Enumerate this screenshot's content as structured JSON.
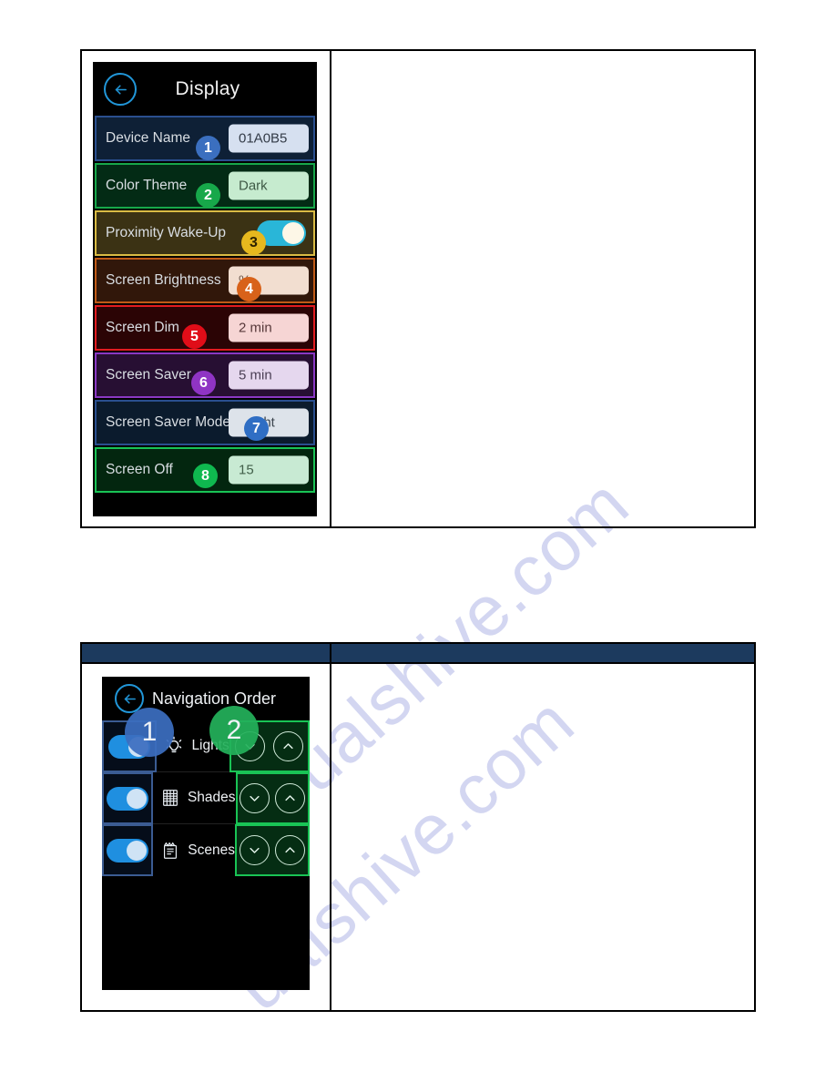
{
  "document": {
    "watermark": "ualshive.com"
  },
  "panel1": {
    "device": {
      "title": "Display",
      "back_icon": "arrow-left-icon",
      "rows": [
        {
          "label": "Device Name",
          "value": "01A0B5",
          "badge": "1",
          "badge_color": "#3b6fbf",
          "control": "value"
        },
        {
          "label": "Color Theme",
          "value": "Dark",
          "badge": "2",
          "badge_color": "#17a84a",
          "control": "value"
        },
        {
          "label": "Proximity Wake-Up",
          "value": "",
          "badge": "3",
          "badge_color": "#e6b81e",
          "control": "toggle"
        },
        {
          "label": "Screen Brightness",
          "value": "%",
          "badge": "4",
          "badge_color": "#d8621a",
          "control": "value"
        },
        {
          "label": "Screen Dim",
          "value": "2 min",
          "badge": "5",
          "badge_color": "#e00d18",
          "control": "value"
        },
        {
          "label": "Screen Saver",
          "value": "5 min",
          "badge": "6",
          "badge_color": "#8f34c4",
          "control": "value"
        },
        {
          "label": "Screen Saver Mode",
          "value": "ght",
          "badge": "7",
          "badge_color": "#2f6ec4",
          "control": "value"
        },
        {
          "label": "Screen Off",
          "value": "15",
          "badge": "8",
          "badge_color": "#0fb84f",
          "control": "value"
        }
      ]
    },
    "right_cell": ""
  },
  "panel2": {
    "header_color": "#1c3a5e",
    "header_left": "",
    "header_right": "",
    "device": {
      "title": "Navigation Order",
      "back_icon": "arrow-left-icon",
      "rows": [
        {
          "label": "Lights",
          "icon": "lightbulb-icon",
          "toggle": "on",
          "down": "chevron-down-icon",
          "up": "chevron-up-icon"
        },
        {
          "label": "Shades",
          "icon": "blinds-icon",
          "toggle": "on",
          "down": "chevron-down-icon",
          "up": "chevron-up-icon"
        },
        {
          "label": "Scenes",
          "icon": "scenes-icon",
          "toggle": "on",
          "down": "chevron-down-icon",
          "up": "chevron-up-icon"
        }
      ],
      "badges": [
        {
          "num": "1",
          "color": "#3b6ebf"
        },
        {
          "num": "2",
          "color": "#23b05a"
        }
      ]
    },
    "right_cell": ""
  }
}
